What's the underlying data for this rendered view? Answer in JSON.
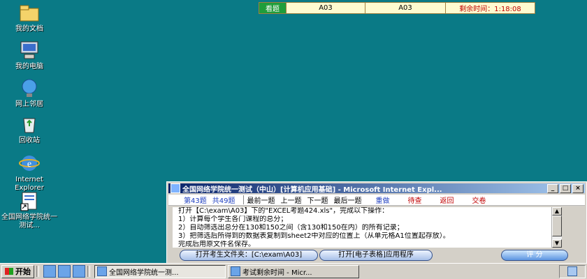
{
  "desktop": {
    "icons": [
      {
        "label": "我的文档",
        "icon": "folder-icon"
      },
      {
        "label": "我的电脑",
        "icon": "computer-icon"
      },
      {
        "label": "网上邻居",
        "icon": "network-icon"
      },
      {
        "label": "回收站",
        "icon": "recycle-bin-icon"
      },
      {
        "label": "Internet Explorer",
        "icon": "ie-icon"
      },
      {
        "label": "全国网络学院统一测试...",
        "icon": "shortcut-icon"
      }
    ]
  },
  "statusbar": {
    "mode": "看题",
    "field1": "A03",
    "field2": "A03",
    "time": "剩余时间：1:18:08"
  },
  "window": {
    "title": "全国网络学院统一测试（中山）[计算机应用基础] - Microsoft Internet Expl...",
    "nav": {
      "current_label": "第43题",
      "total_label": "共49题",
      "first": "最前一题",
      "prev": "上一题",
      "next": "下一题",
      "last": "最后一题",
      "redo": "重做",
      "pending": "待查",
      "back": "返回",
      "submit": "交卷"
    },
    "content": [
      "打开【C:\\exam\\A03】下的\"EXCEL考题424.xls\"，完成以下操作：",
      "1）计算每个学生各门课程的总分；",
      "2）自动筛选出总分在130和150之间（含130和150在内）的所有记录；",
      "3）把筛选后所得到的数据表复制到sheet2中对应的位置上（从单元格A1位置起存放）。",
      "完成后用原文件名保存。"
    ],
    "buttons": {
      "open_folder": "打开考生文件夹：[C:\\exam\\A03]",
      "open_app": "打开[电子表格]应用程序",
      "score": "评  分"
    }
  },
  "taskbar": {
    "start": "开始",
    "tasks": [
      "全国网络学院统一测...",
      "考试剩余时间 - Micr..."
    ]
  }
}
